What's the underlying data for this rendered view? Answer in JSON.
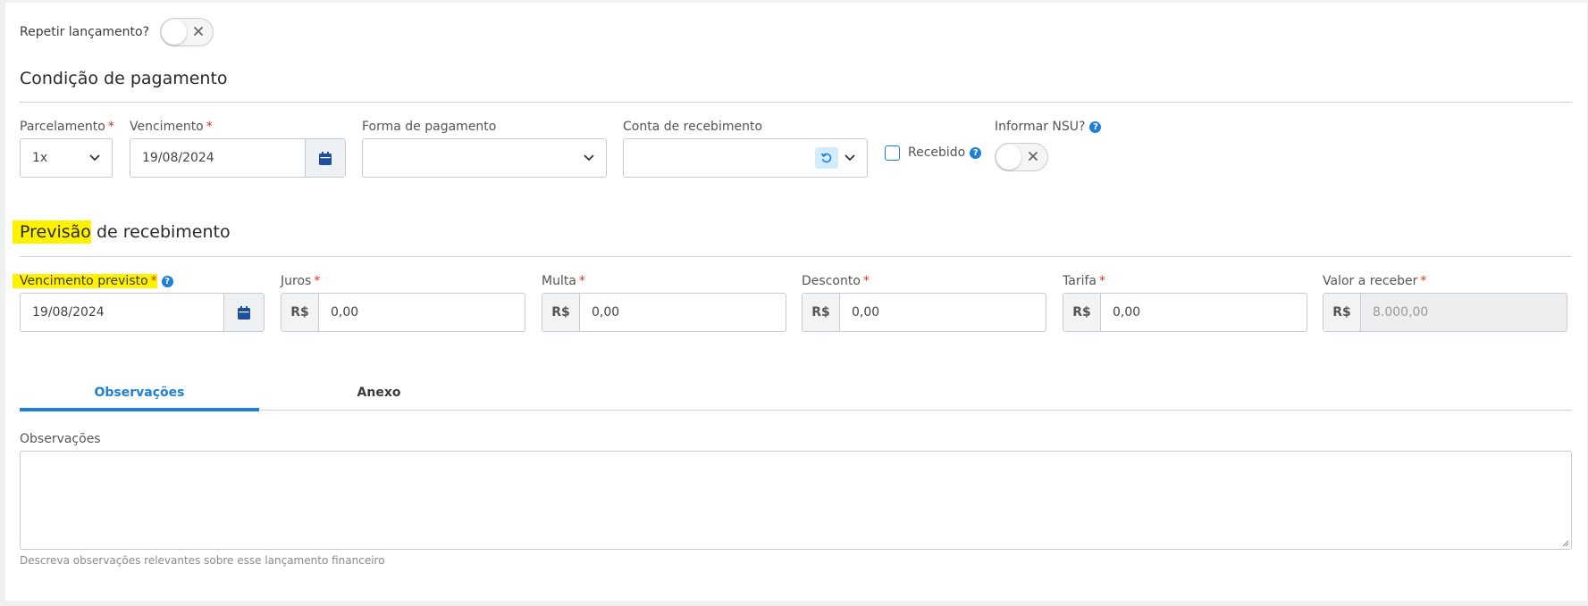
{
  "repeat": {
    "label": "Repetir lançamento?"
  },
  "payment": {
    "title": "Condição de pagamento",
    "installments": {
      "label": "Parcelamento",
      "required_mark": "*",
      "value": "1x"
    },
    "due": {
      "label": "Vencimento",
      "required_mark": "*",
      "value": "19/08/2024"
    },
    "method": {
      "label": "Forma de pagamento",
      "value": ""
    },
    "account": {
      "label": "Conta de recebimento",
      "value": ""
    },
    "received": {
      "label": "Recebido"
    },
    "nsu": {
      "label": "Informar NSU?"
    }
  },
  "forecast": {
    "title_highlight": "Previsão",
    "title_rest": " de recebimento",
    "expected_due": {
      "label": "Vencimento previsto",
      "required_mark": "*",
      "value": "19/08/2024"
    },
    "interest": {
      "label": "Juros",
      "required_mark": "*",
      "prefix": "R$",
      "value": "0,00"
    },
    "fine": {
      "label": "Multa",
      "required_mark": "*",
      "prefix": "R$",
      "value": "0,00"
    },
    "discount": {
      "label": "Desconto",
      "required_mark": "*",
      "prefix": "R$",
      "value": "0,00"
    },
    "fee": {
      "label": "Tarifa",
      "required_mark": "*",
      "prefix": "R$",
      "value": "0,00"
    },
    "amount": {
      "label": "Valor a receber",
      "required_mark": "*",
      "prefix": "R$",
      "value": "8.000,00"
    }
  },
  "tabs": [
    {
      "label": "Observações",
      "active": true
    },
    {
      "label": "Anexo",
      "active": false
    }
  ],
  "notes": {
    "label": "Observações",
    "value": "",
    "hint": "Descreva observações relevantes sobre esse lançamento financeiro"
  },
  "colors": {
    "accent": "#1e7fd6",
    "calendar_icon": "#1f4f9c",
    "required": "#d9342b",
    "highlight": "#fff200"
  }
}
